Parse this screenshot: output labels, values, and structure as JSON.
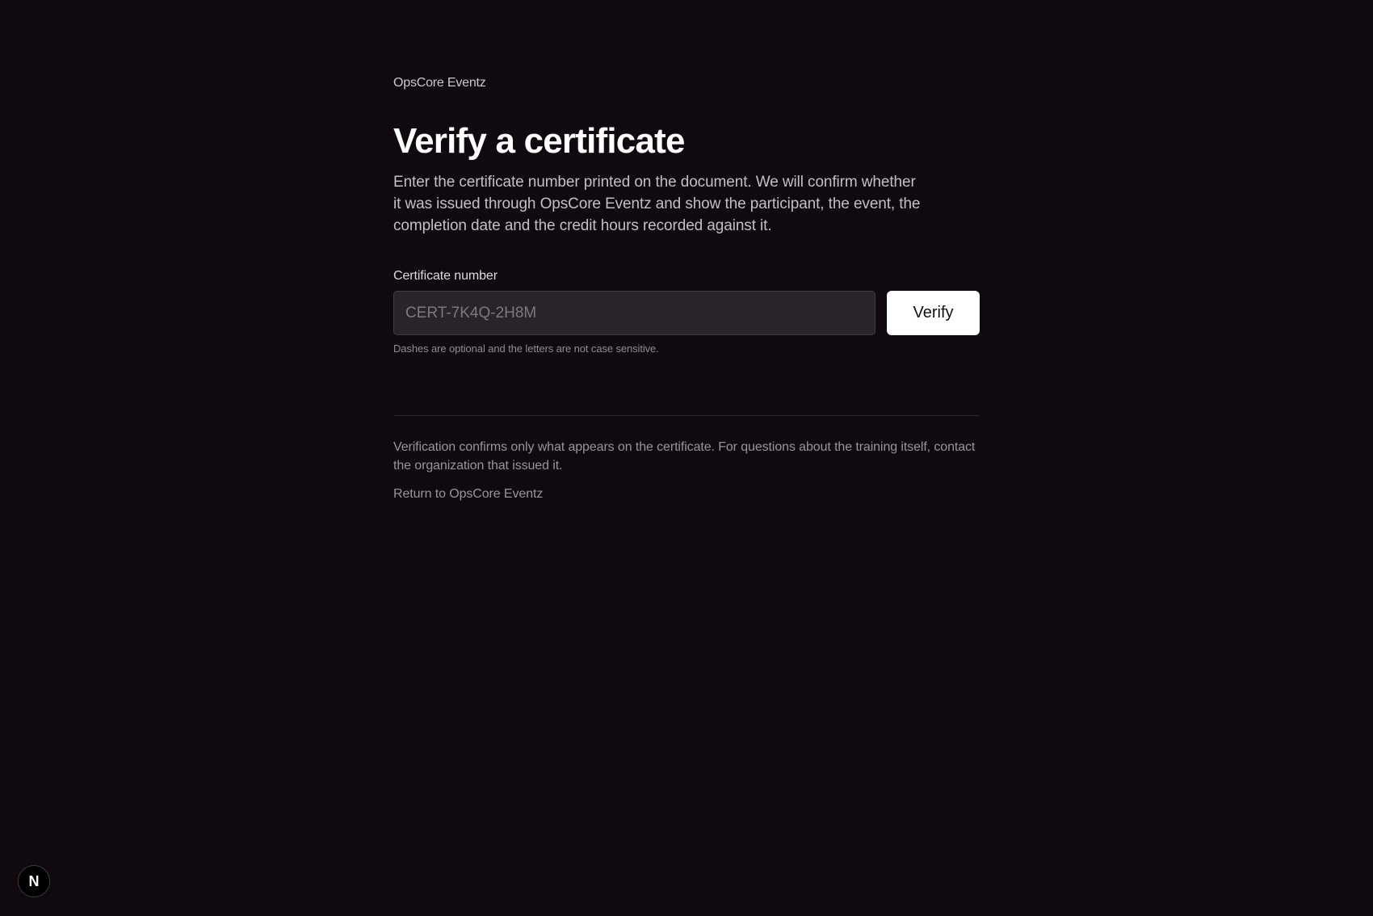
{
  "brand": {
    "name": "OpsCore Eventz"
  },
  "main": {
    "title": "Verify a certificate",
    "intro": "Enter the certificate number printed on the document. We will confirm whether it was issued through OpsCore Eventz and show the participant, the event, the completion date and the credit hours recorded against it."
  },
  "form": {
    "label": "Certificate number",
    "value": "",
    "placeholder": "CERT-7K4Q-2H8M",
    "submit_label": "Verify",
    "hint": "Dashes are optional and the letters are not case sensitive."
  },
  "footer": {
    "note": "Verification confirms only what appears on the certificate. For questions about the training itself, contact the organization that issued it.",
    "return_link": "Return to OpsCore Eventz"
  },
  "dev_badge": {
    "glyph": "N",
    "icon": "nextjs-logo-icon"
  },
  "colors": {
    "background": "#100a10",
    "input_background": "#2a232b",
    "button_background": "#ffffff",
    "button_text": "#111111"
  }
}
